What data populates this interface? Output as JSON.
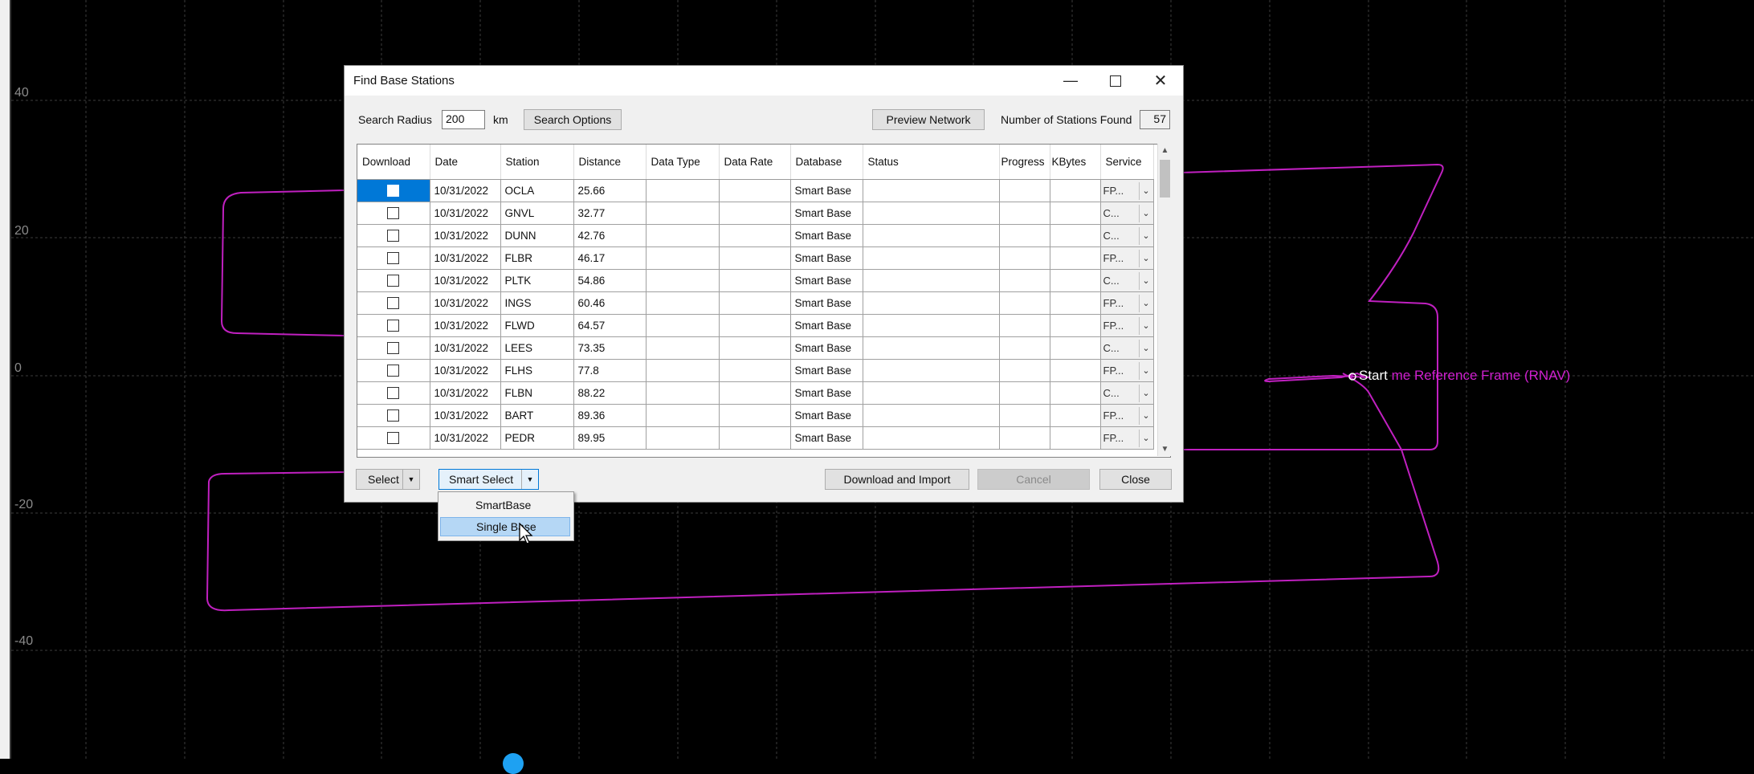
{
  "plot": {
    "y_axis_labels": [
      "40",
      "20",
      "0",
      "-20",
      "-40"
    ],
    "track_color": "#c020c0",
    "track_label_start": "Start",
    "track_label_suffix": "me Reference Frame (RNAV)"
  },
  "dialog": {
    "title": "Find Base Stations",
    "search_radius_label": "Search Radius",
    "search_radius_value": "200",
    "radius_unit": "km",
    "search_options_label": "Search Options",
    "preview_network_label": "Preview Network",
    "stations_found_label": "Number of Stations Found",
    "stations_found_value": "57",
    "columns": [
      "Download",
      "Date",
      "Station",
      "Distance",
      "Data Type",
      "Data Rate",
      "Database",
      "Status",
      "Progress",
      "KBytes",
      "Service"
    ],
    "rows": [
      {
        "date": "10/31/2022",
        "station": "OCLA",
        "distance": "25.66",
        "database": "Smart Base",
        "service": "FP..."
      },
      {
        "date": "10/31/2022",
        "station": "GNVL",
        "distance": "32.77",
        "database": "Smart Base",
        "service": "C..."
      },
      {
        "date": "10/31/2022",
        "station": "DUNN",
        "distance": "42.76",
        "database": "Smart Base",
        "service": "C..."
      },
      {
        "date": "10/31/2022",
        "station": "FLBR",
        "distance": "46.17",
        "database": "Smart Base",
        "service": "FP..."
      },
      {
        "date": "10/31/2022",
        "station": "PLTK",
        "distance": "54.86",
        "database": "Smart Base",
        "service": "C..."
      },
      {
        "date": "10/31/2022",
        "station": "INGS",
        "distance": "60.46",
        "database": "Smart Base",
        "service": "FP..."
      },
      {
        "date": "10/31/2022",
        "station": "FLWD",
        "distance": "64.57",
        "database": "Smart Base",
        "service": "FP..."
      },
      {
        "date": "10/31/2022",
        "station": "LEES",
        "distance": "73.35",
        "database": "Smart Base",
        "service": "C..."
      },
      {
        "date": "10/31/2022",
        "station": "FLHS",
        "distance": "77.8",
        "database": "Smart Base",
        "service": "FP..."
      },
      {
        "date": "10/31/2022",
        "station": "FLBN",
        "distance": "88.22",
        "database": "Smart Base",
        "service": "C..."
      },
      {
        "date": "10/31/2022",
        "station": "BART",
        "distance": "89.36",
        "database": "Smart Base",
        "service": "FP..."
      },
      {
        "date": "10/31/2022",
        "station": "PEDR",
        "distance": "89.95",
        "database": "Smart Base",
        "service": "FP..."
      }
    ],
    "select_label": "Select",
    "smart_select_label": "Smart Select",
    "download_import_label": "Download and Import",
    "cancel_label": "Cancel",
    "close_label": "Close",
    "smart_select_menu": [
      "SmartBase",
      "Single Base"
    ]
  }
}
